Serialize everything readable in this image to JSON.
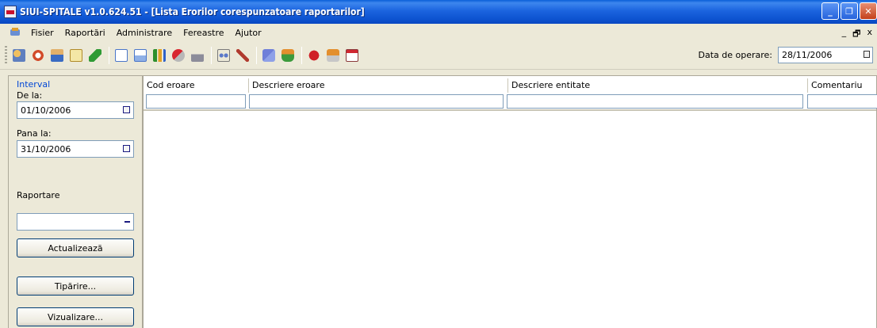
{
  "window": {
    "title": "SIUI-SPITALE v1.0.624.51 - [Lista Erorilor corespunzatoare raportarilor]",
    "colors": {
      "title_bar": "#0a5fd8",
      "background": "#ece9d8",
      "label_blue": "#0046d5"
    }
  },
  "menu": {
    "items": [
      "Fisier",
      "Raportări",
      "Administrare",
      "Fereastre",
      "Ajutor"
    ],
    "mdi_controls": [
      "_",
      "🗗",
      "x"
    ]
  },
  "toolbar": {
    "icons": [
      "users-icon",
      "refresh-icon",
      "person-icon",
      "document-icon",
      "pen-icon",
      "page-icon",
      "image-icon",
      "chart-icon",
      "pill-icon",
      "stamp-icon",
      "glasses-icon",
      "wrench-icon",
      "check-icon",
      "bottle-icon",
      "medical-cross-icon",
      "syringe-icon",
      "calendar-icon"
    ],
    "date_label": "Data de operare:",
    "date_value": "28/11/2006"
  },
  "filters": {
    "interval_label": "Interval",
    "from_label": "De la:",
    "from_value": "01/10/2006",
    "to_label": "Pana la:",
    "to_value": "31/10/2006",
    "reporter_label": "Raportare",
    "reporter_value": "",
    "refresh_button": "Actualizează",
    "print_button": "Tipărire...",
    "preview_button": "Vizualizare..."
  },
  "grid": {
    "columns": [
      "Cod eroare",
      "Descriere eroare",
      "Descriere entitate",
      "Comentariu"
    ]
  }
}
